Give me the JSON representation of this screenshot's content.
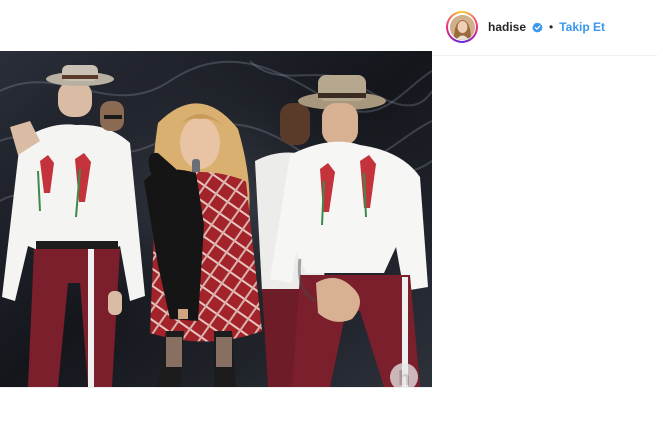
{
  "post": {
    "username": "hadise",
    "separator": "•",
    "follow_label": "Takip Et",
    "verified": true
  },
  "photo": {
    "watermark_letter": "h"
  },
  "icons": {
    "avatar": "profile-photo-avatar",
    "verified": "verified-badge-icon"
  },
  "colors": {
    "link_blue": "#3897f0",
    "verified_blue": "#3897f0",
    "text": "#262626",
    "divider": "#efefef"
  }
}
